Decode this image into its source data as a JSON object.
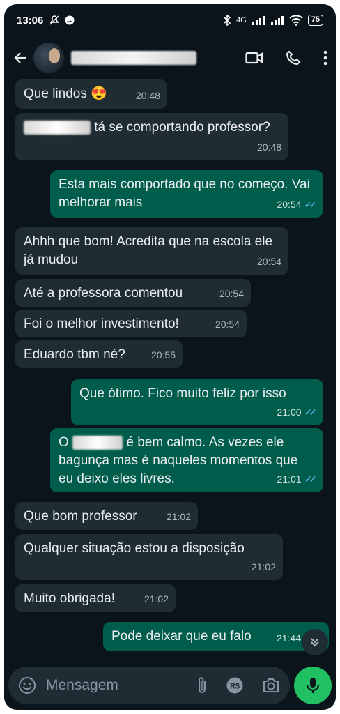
{
  "status_bar": {
    "time": "13:06",
    "network": "4G",
    "battery": "75"
  },
  "header": {
    "back_icon": "arrow-left-icon",
    "contact_name": "",
    "video_icon": "video-call-icon",
    "call_icon": "phone-icon",
    "menu_icon": "more-vertical-icon"
  },
  "messages": [
    {
      "dir": "in",
      "text": "Que lindos 😍",
      "time": "20:48"
    },
    {
      "dir": "in",
      "text": "tá se comportando professor?",
      "time": "20:48"
    },
    {
      "dir": "out",
      "text": "Esta mais comportado que no começo. Vai melhorar mais",
      "time": "20:54",
      "read": true
    },
    {
      "dir": "in",
      "text": "Ahhh que bom! Acredita que na escola ele já mudou",
      "time": "20:54"
    },
    {
      "dir": "in",
      "text": "Até a professora comentou",
      "time": "20:54"
    },
    {
      "dir": "in",
      "text": "Foi o melhor investimento!",
      "time": "20:54"
    },
    {
      "dir": "in",
      "text": "Eduardo tbm né?",
      "time": "20:55"
    },
    {
      "dir": "out",
      "text": "Que ótimo. Fico muito feliz por isso",
      "time": "21:00",
      "read": true
    },
    {
      "dir": "out",
      "text_before": "O",
      "text_after": "é bem calmo. As vezes ele bagunça mas é naqueles momentos que eu deixo eles livres.",
      "time": "21:01",
      "read": true
    },
    {
      "dir": "in",
      "text": "Que bom professor",
      "time": "21:02"
    },
    {
      "dir": "in",
      "text": "Qualquer situação estou a disposição",
      "time": "21:02"
    },
    {
      "dir": "in",
      "text": "Muito obrigada!",
      "time": "21:02"
    },
    {
      "dir": "out",
      "text": "Pode deixar que eu falo",
      "time": "21:44"
    }
  ],
  "composer": {
    "placeholder": "Mensagem",
    "emoji_icon": "emoji-icon",
    "attach_icon": "paperclip-icon",
    "payment_icon": "payment-icon",
    "payment_label": "R$",
    "camera_icon": "camera-icon",
    "mic_icon": "microphone-icon"
  },
  "colors": {
    "background": "#0b141a",
    "incoming": "#1f2c34",
    "outgoing": "#005c4b",
    "accent": "#21c063",
    "read_ticks": "#53bdeb"
  }
}
